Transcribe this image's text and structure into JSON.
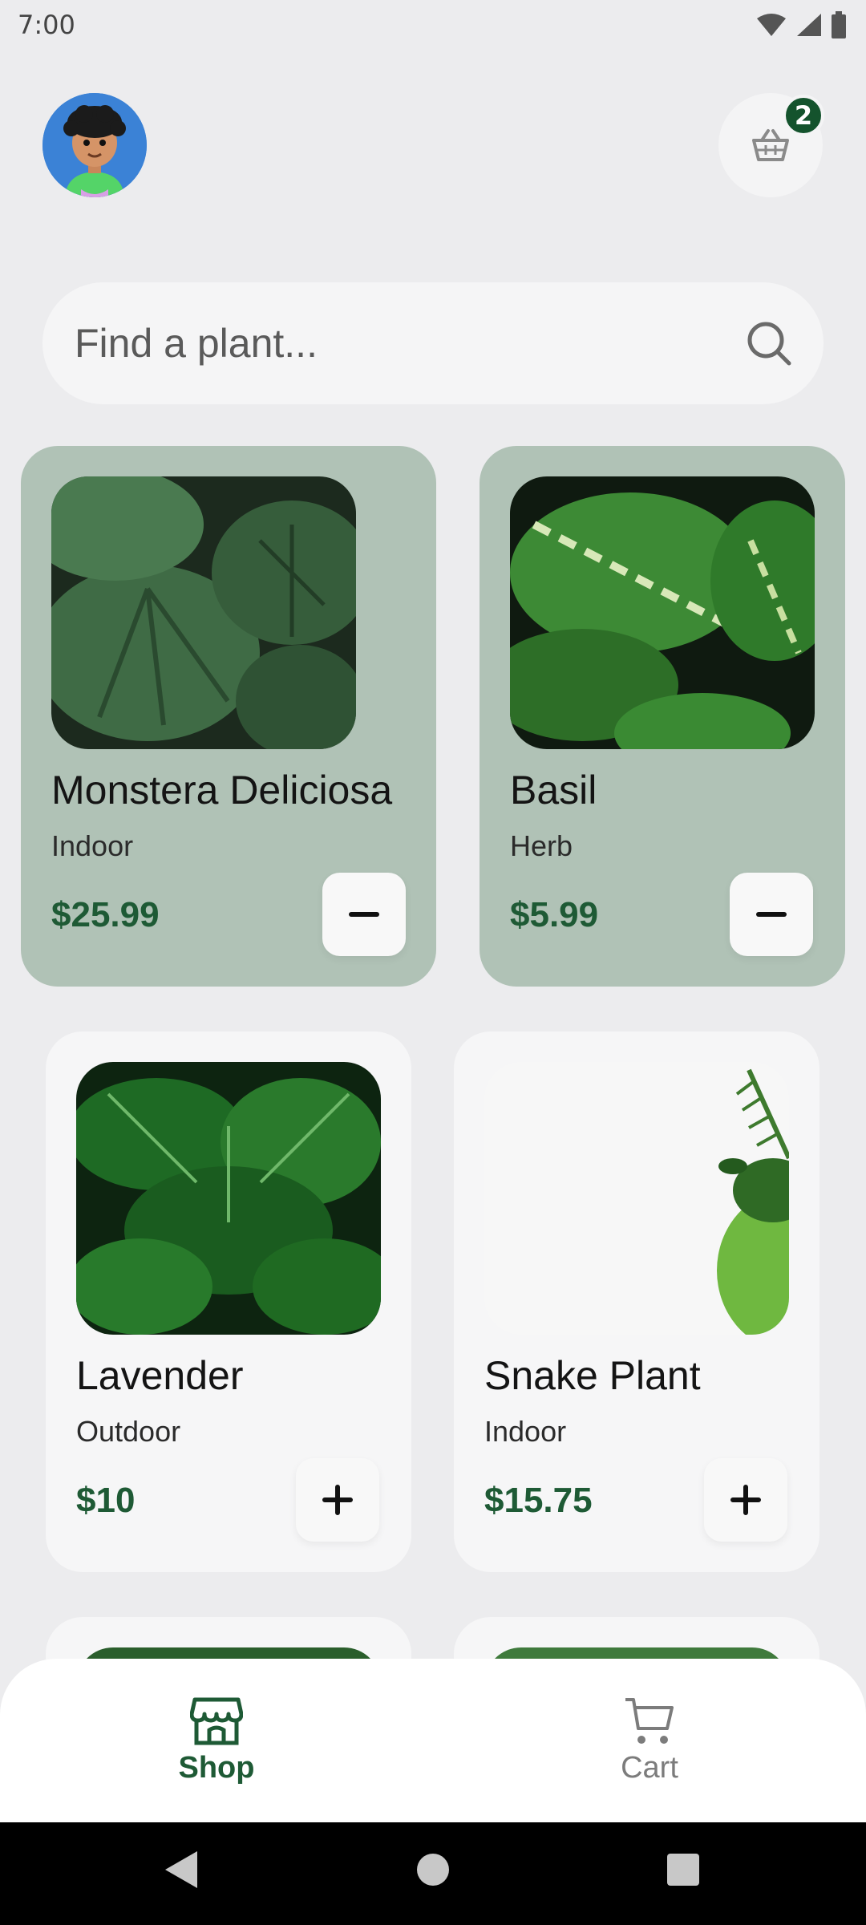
{
  "status_bar": {
    "time": "7:00"
  },
  "header": {
    "cart_count": "2"
  },
  "search": {
    "placeholder": "Find a plant..."
  },
  "products": [
    {
      "name": "Monstera Deliciosa",
      "category": "Indoor",
      "price": "$25.99",
      "in_cart": true,
      "action_icon": "minus-icon"
    },
    {
      "name": "Basil",
      "category": "Herb",
      "price": "$5.99",
      "in_cart": true,
      "action_icon": "minus-icon"
    },
    {
      "name": "Lavender",
      "category": "Outdoor",
      "price": "$10",
      "in_cart": false,
      "action_icon": "plus-icon"
    },
    {
      "name": "Snake Plant",
      "category": "Indoor",
      "price": "$15.75",
      "in_cart": false,
      "action_icon": "plus-icon"
    }
  ],
  "bottom_nav": [
    {
      "label": "Shop",
      "icon": "store-icon",
      "active": true
    },
    {
      "label": "Cart",
      "icon": "cart-icon",
      "active": false
    }
  ],
  "colors": {
    "accent": "#1e5a35",
    "selected_card": "#b0c2b6",
    "card": "#f6f6f7",
    "background": "#ececee",
    "badge": "#14532d"
  }
}
